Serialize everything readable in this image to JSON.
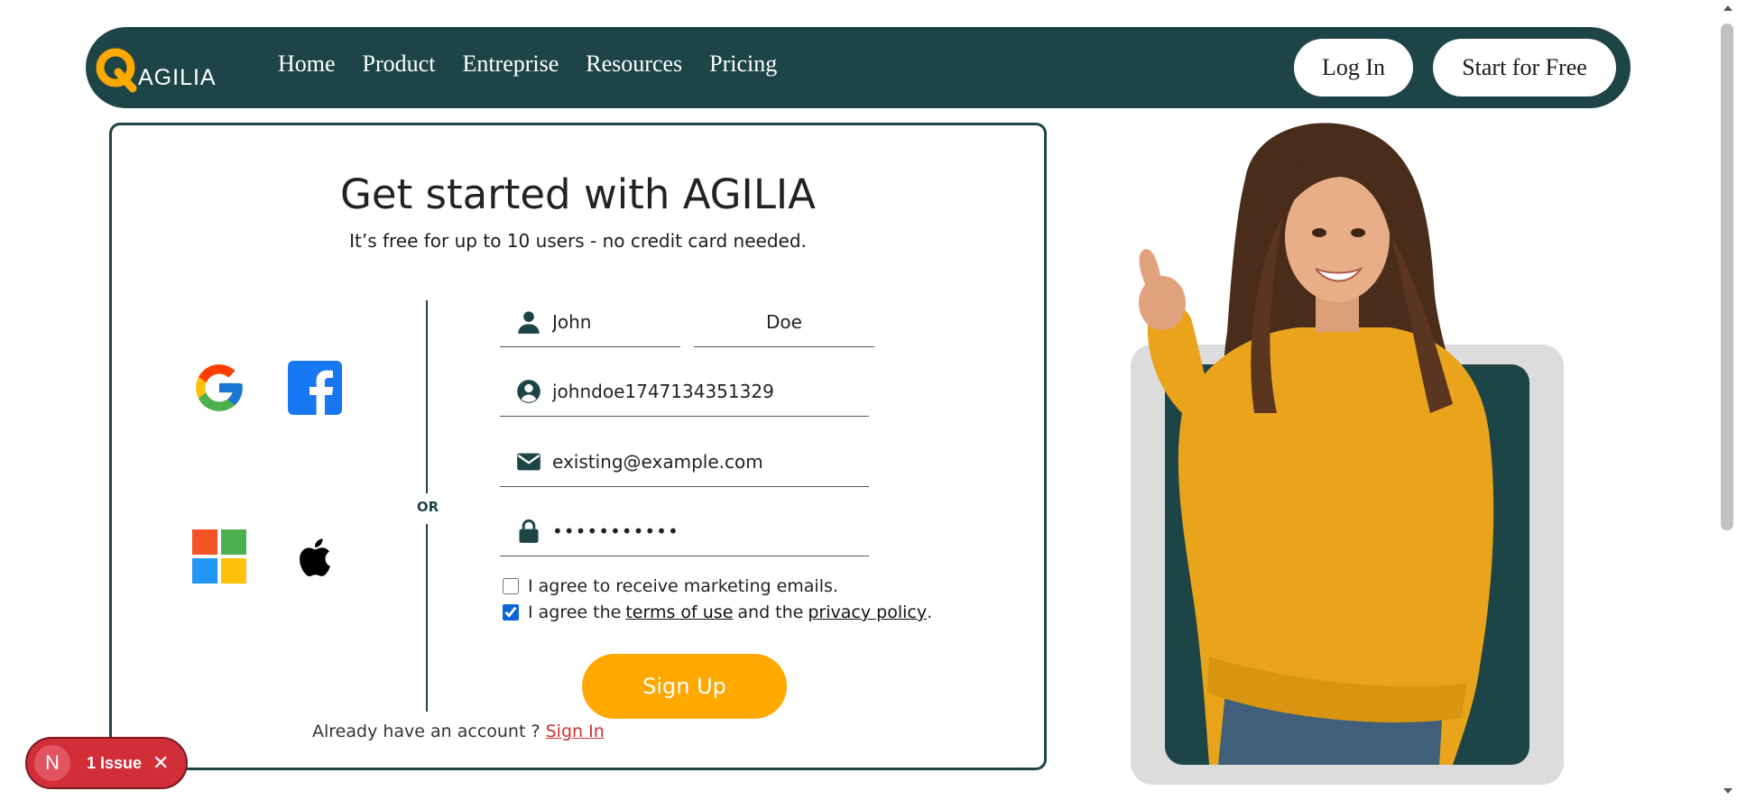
{
  "colors": {
    "brand_dark": "#1d4548",
    "accent": "#ffa800",
    "link_red": "#d32f2f",
    "issue_red": "#d22e3a"
  },
  "nav": {
    "logo_text": "AGILIA",
    "links": [
      "Home",
      "Product",
      "Entreprise",
      "Resources",
      "Pricing"
    ],
    "login_label": "Log In",
    "start_label": "Start for Free"
  },
  "signup": {
    "title": "Get started with AGILIA",
    "subtitle": "It’s free for up to 10 users - no credit card needed.",
    "social_icons": [
      "google-icon",
      "facebook-icon",
      "microsoft-icon",
      "apple-icon"
    ],
    "or_label": "OR",
    "first_name": "John",
    "last_name": "Doe",
    "username": "johndoe1747134351329",
    "email": "existing@example.com",
    "password": "•••••••••••",
    "marketing_label": "I agree to receive marketing emails.",
    "marketing_checked": false,
    "terms_prefix": "I agree the",
    "terms_link": "terms of use",
    "terms_middle": "and the",
    "privacy_link": "privacy policy",
    "terms_suffix": ".",
    "terms_checked": true,
    "submit_label": "Sign Up",
    "already_text": "Already have an account ?",
    "signin_link": "Sign In"
  },
  "issue_badge": {
    "avatar_letter": "N",
    "label": "1 Issue",
    "close": "✕"
  }
}
